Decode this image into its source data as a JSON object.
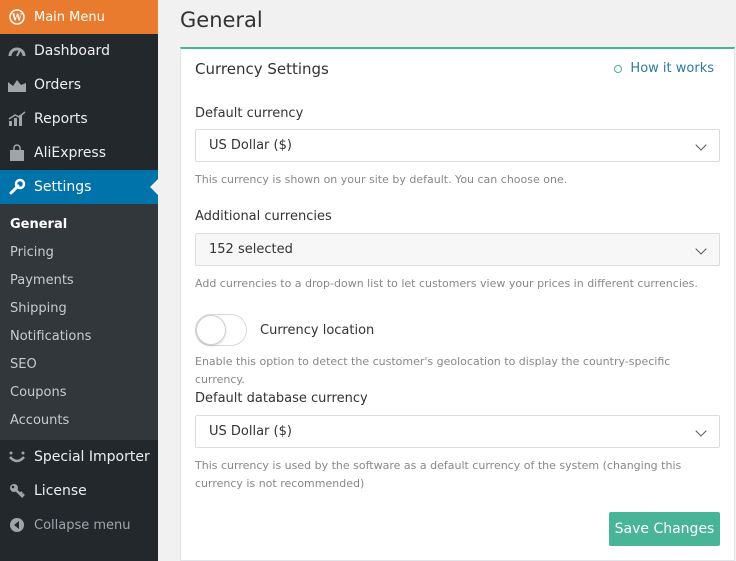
{
  "sidebar": {
    "main_menu": "Main Menu",
    "items": [
      {
        "label": "Dashboard",
        "icon": "dashboard-icon"
      },
      {
        "label": "Orders",
        "icon": "orders-chart-icon"
      },
      {
        "label": "Reports",
        "icon": "reports-chart-icon"
      },
      {
        "label": "AliExpress",
        "icon": "shopping-bag-icon"
      },
      {
        "label": "Settings",
        "icon": "wrench-icon"
      }
    ],
    "submenu": [
      "General",
      "Pricing",
      "Payments",
      "Shipping",
      "Notifications",
      "SEO",
      "Coupons",
      "Accounts"
    ],
    "bottom_items": [
      {
        "label": "Special Importer",
        "icon": "smile-icon"
      },
      {
        "label": "License",
        "icon": "key-icon"
      }
    ],
    "collapse": "Collapse menu"
  },
  "page": {
    "title": "General"
  },
  "panel": {
    "title": "Currency Settings",
    "how_link": "How it works",
    "default_currency": {
      "label": "Default currency",
      "value": "US Dollar ($)",
      "help": "This currency is shown on your site by default. You can choose one."
    },
    "additional_currencies": {
      "label": "Additional currencies",
      "value": "152 selected",
      "help": "Add currencies to a drop-down list to let customers view your prices in different currencies."
    },
    "currency_location": {
      "label": "Currency location",
      "help": "Enable this option to detect the customer's geolocation to display the country-specific currency."
    },
    "default_db_currency": {
      "label": "Default database currency",
      "value": "US Dollar ($)",
      "help": "This currency is used by the software as a default currency of the system (changing this currency is not recommended)"
    },
    "save": "Save Changes"
  },
  "colors": {
    "accent": "#48b596",
    "main_menu": "#e97b2e",
    "active": "#0073aa",
    "sidebar": "#23282d"
  }
}
